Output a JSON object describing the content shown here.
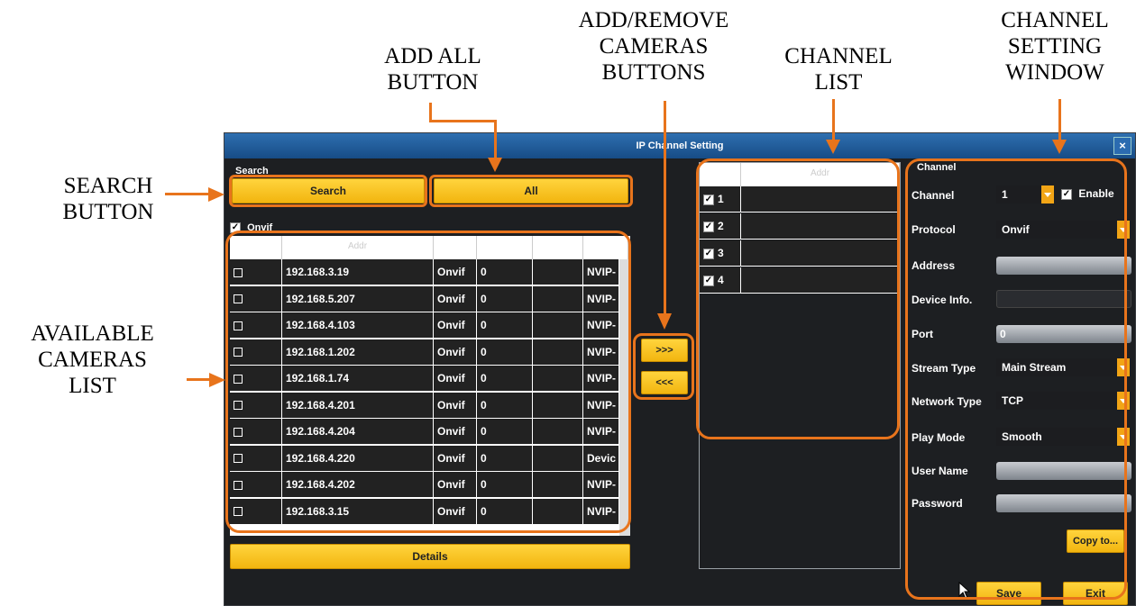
{
  "annotations": {
    "add_all": [
      "ADD ALL",
      "BUTTON"
    ],
    "add_remove": [
      "ADD/REMOVE",
      "CAMERAS",
      "BUTTONS"
    ],
    "channel_list": [
      "CHANNEL",
      "LIST"
    ],
    "channel_setting": [
      "CHANNEL",
      "SETTING",
      "WINDOW"
    ],
    "search": [
      "SEARCH",
      "BUTTON"
    ],
    "available": [
      "AVAILABLE",
      "CAMERAS",
      "LIST"
    ]
  },
  "window": {
    "title": "IP Channel Setting",
    "close": "×"
  },
  "search_section": {
    "label": "Search",
    "search_button": "Search",
    "all_button": "All",
    "onvif_label": "Onvif",
    "onvif_checked": "✓"
  },
  "cameras_table": {
    "header": [
      "",
      "Addr",
      "",
      "",
      "",
      ""
    ],
    "rows": [
      {
        "addr": "192.168.3.19",
        "proto": "Onvif",
        "port": "0",
        "model": "NVIP-"
      },
      {
        "addr": "192.168.5.207",
        "proto": "Onvif",
        "port": "0",
        "model": "NVIP-"
      },
      {
        "addr": "192.168.4.103",
        "proto": "Onvif",
        "port": "0",
        "model": "NVIP-"
      },
      {
        "addr": "192.168.1.202",
        "proto": "Onvif",
        "port": "0",
        "model": "NVIP-"
      },
      {
        "addr": "192.168.1.74",
        "proto": "Onvif",
        "port": "0",
        "model": "NVIP-"
      },
      {
        "addr": "192.168.4.201",
        "proto": "Onvif",
        "port": "0",
        "model": "NVIP-"
      },
      {
        "addr": "192.168.4.204",
        "proto": "Onvif",
        "port": "0",
        "model": "NVIP-"
      },
      {
        "addr": "192.168.4.220",
        "proto": "Onvif",
        "port": "0",
        "model": "Devic"
      },
      {
        "addr": "192.168.4.202",
        "proto": "Onvif",
        "port": "0",
        "model": "NVIP-"
      },
      {
        "addr": "192.168.3.15",
        "proto": "Onvif",
        "port": "0",
        "model": "NVIP-"
      }
    ]
  },
  "details_button": "Details",
  "move_buttons": {
    "add": ">>>",
    "remove": "<<<"
  },
  "channel_list": {
    "header": [
      "",
      "Addr"
    ],
    "rows": [
      {
        "num": "1",
        "checked": "✓"
      },
      {
        "num": "2",
        "checked": "✓"
      },
      {
        "num": "3",
        "checked": "✓"
      },
      {
        "num": "4",
        "checked": "✓"
      }
    ]
  },
  "channel_settings": {
    "section": "Channel",
    "channel_label": "Channel",
    "channel_value": "1",
    "enable_label": "Enable",
    "enable_checked": "✓",
    "protocol_label": "Protocol",
    "protocol_value": "Onvif",
    "address_label": "Address",
    "device_info_label": "Device Info.",
    "port_label": "Port",
    "port_value": "0",
    "stream_type_label": "Stream Type",
    "stream_type_value": "Main Stream",
    "network_type_label": "Network Type",
    "network_type_value": "TCP",
    "play_mode_label": "Play Mode",
    "play_mode_value": "Smooth",
    "user_name_label": "User Name",
    "password_label": "Password",
    "copy_button": "Copy to..."
  },
  "footer": {
    "save": "Save",
    "exit": "Exit"
  },
  "colors": {
    "accent": "#e8741c",
    "button": "#f5bd1a",
    "title": "#1e5a9c"
  }
}
